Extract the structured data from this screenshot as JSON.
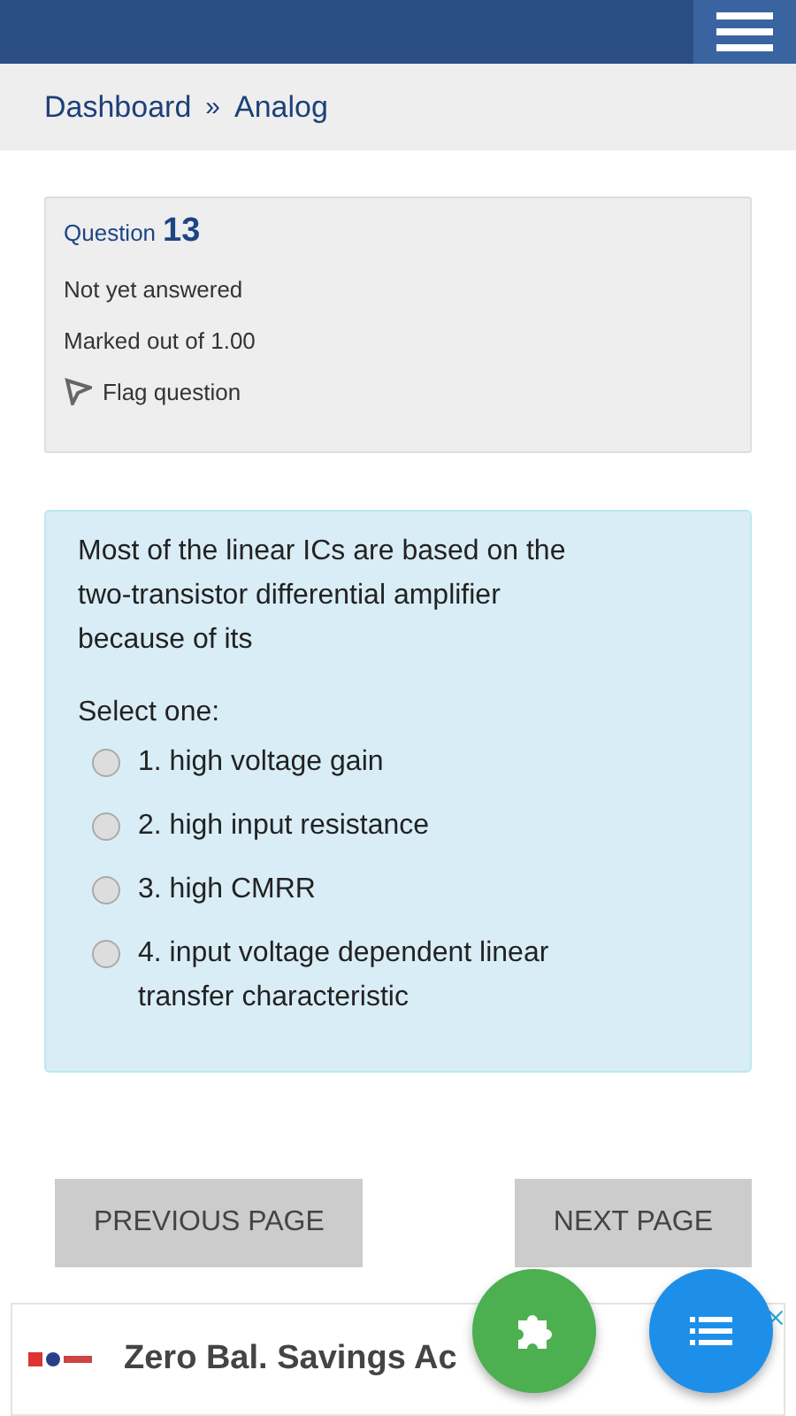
{
  "breadcrumb": [
    "Dashboard",
    "»",
    "Analog"
  ],
  "info": {
    "label": "Question",
    "number": "13",
    "status": "Not yet answered",
    "marks": "Marked out of 1.00",
    "flag": "Flag question"
  },
  "question": {
    "text": "Most of the linear ICs are based on the two-transistor differential amplifier because of its",
    "prompt": "Select one:",
    "options": [
      {
        "label": "1. high voltage gain",
        "selected": false
      },
      {
        "label": "2. high input resistance",
        "selected": false
      },
      {
        "label": "3. high CMRR",
        "selected": false
      },
      {
        "label": "4. input voltage dependent linear transfer characteristic",
        "selected": false
      }
    ]
  },
  "buttons": [
    "PREVIOUS PAGE",
    "NEXT PAGE"
  ],
  "ad": {
    "text": "Zero Bal. Savings Ac"
  }
}
